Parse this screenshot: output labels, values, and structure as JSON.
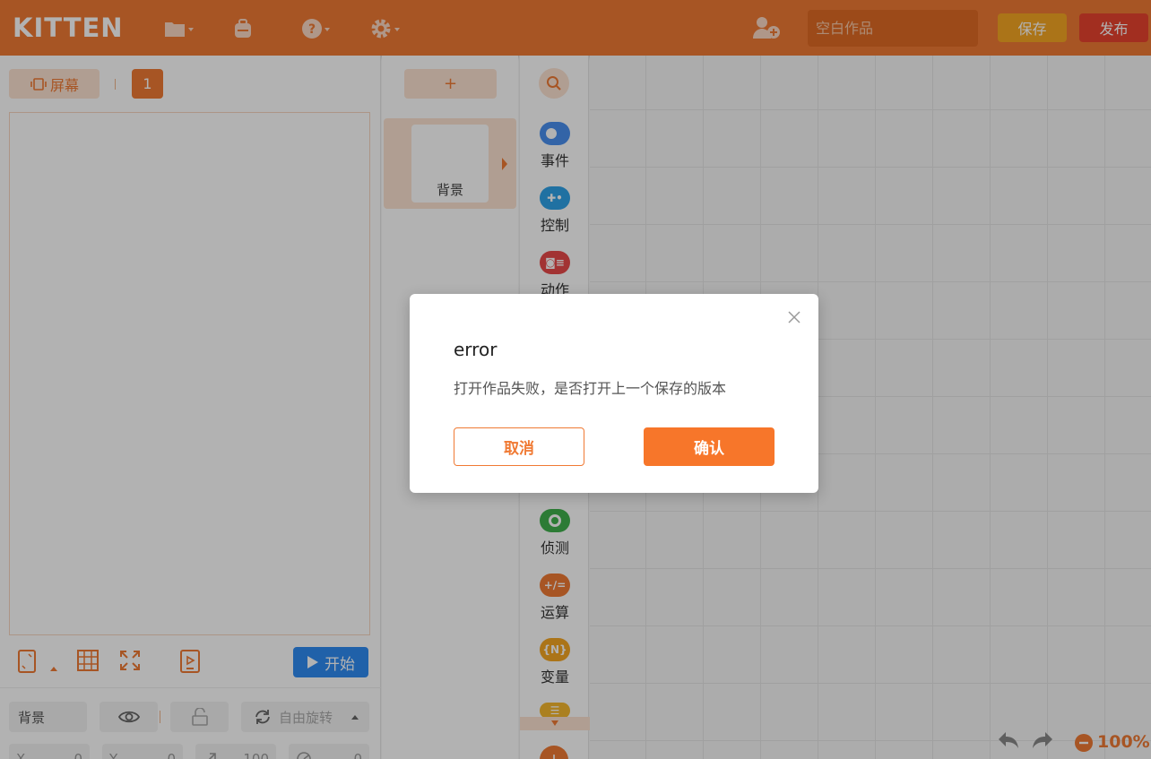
{
  "app": {
    "logo": "KITTEN"
  },
  "header": {
    "project_title_placeholder": "空白作品",
    "save_label": "保存",
    "publish_label": "发布"
  },
  "left_panel": {
    "screen_button_label": "屏幕",
    "current_screen": "1",
    "start_button_label": "开始",
    "properties": {
      "sprite_name": "背景",
      "rotation_mode": "自由旋转",
      "x_value": "0",
      "y_value": "0",
      "scale_value": "100",
      "direction_value": "0"
    }
  },
  "costumes": {
    "add_label": "+",
    "items": [
      {
        "name": "背景"
      }
    ]
  },
  "categories": [
    {
      "label": "事件",
      "color": "#4a90f0"
    },
    {
      "label": "控制",
      "color": "#2fa2e8"
    },
    {
      "label": "动作",
      "color": "#e84a4a"
    },
    {
      "label": "侦测",
      "color": "#3fb14c"
    },
    {
      "label": "运算",
      "color": "#f07a34"
    },
    {
      "label": "变量",
      "color": "#f5a623"
    }
  ],
  "workspace": {
    "zoom": "100%"
  },
  "dialog": {
    "title": "error",
    "message": "打开作品失败，是否打开上一个保存的版本",
    "cancel_label": "取消",
    "confirm_label": "确认"
  },
  "colors": {
    "brand": "#f07a34",
    "save": "#f5a623",
    "publish": "#e8432f",
    "start": "#2f8bf2"
  }
}
